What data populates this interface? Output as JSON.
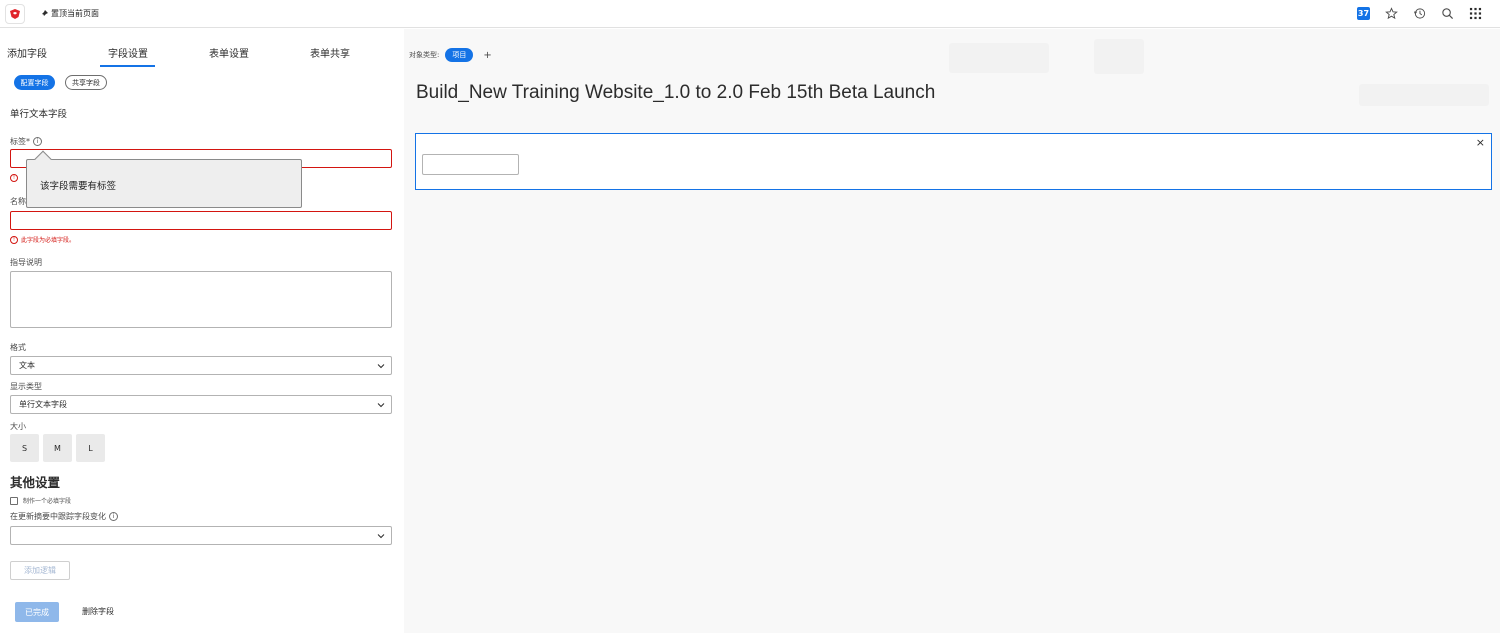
{
  "topbar": {
    "pin_label": "置顶当前页面",
    "notifications_count": "37"
  },
  "left": {
    "tabs": [
      {
        "label": "添加字段"
      },
      {
        "label": "字段设置"
      },
      {
        "label": "表单设置"
      },
      {
        "label": "表单共享"
      }
    ],
    "pills": {
      "configure": "配置字段",
      "shared": "共享字段"
    },
    "field_type": "单行文本字段",
    "label_field": {
      "label": "标签*",
      "error": "!"
    },
    "tooltip": "该字段需要有标签",
    "name_field": {
      "label": "名称",
      "error": "此字段为必填字段。"
    },
    "instructions": {
      "label": "指导说明"
    },
    "format": {
      "label": "格式",
      "value": "文本"
    },
    "display_type": {
      "label": "显示类型",
      "value": "单行文本字段"
    },
    "size": {
      "label": "大小",
      "options": [
        "S",
        "M",
        "L"
      ]
    },
    "other_settings": "其他设置",
    "required_checkbox": "制作一个必填字段",
    "track_changes": {
      "label": "在更新摘要中跟踪字段变化",
      "value": ""
    },
    "add_logic": "添加逻辑",
    "done": "已完成",
    "delete": "删除字段"
  },
  "preview": {
    "object_type_label": "对象类型:",
    "object_type_value": "项目",
    "add": "+",
    "title": "Build_New Training Website_1.0 to 2.0 Feb 15th Beta Launch",
    "close": "×"
  }
}
